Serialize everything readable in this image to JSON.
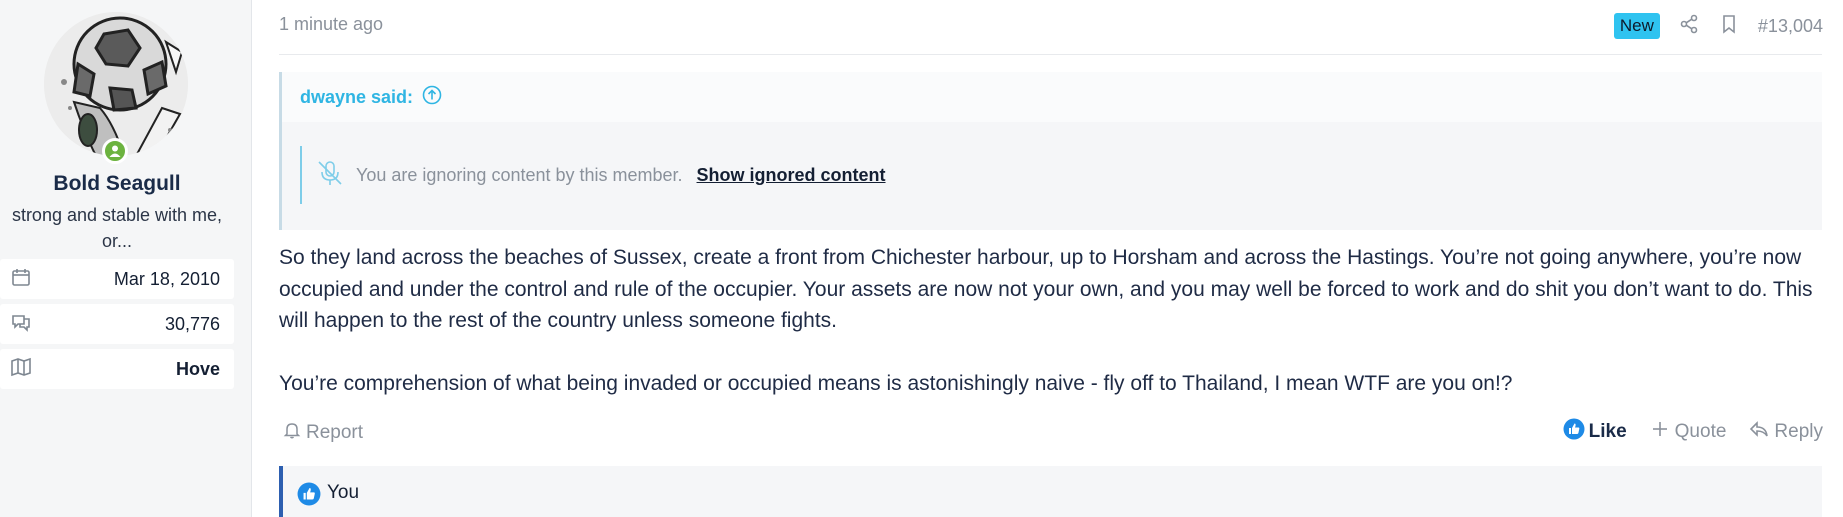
{
  "user": {
    "name": "Bold Seagull",
    "title": "strong and stable with me, or...",
    "icons": {
      "avatar": "football-cartoon-avatar",
      "online": "online-status-icon"
    },
    "stats": [
      {
        "icon": "calendar-icon",
        "value": "Mar 18, 2010"
      },
      {
        "icon": "messages-icon",
        "value": "30,776"
      },
      {
        "icon": "map-icon",
        "value": "Hove"
      }
    ]
  },
  "message": {
    "time": "1 minute ago",
    "badge": "New",
    "post_number": "#13,004",
    "quote": {
      "author": "dwayne said:",
      "ignored_text": "You are ignoring content by this member.",
      "ignored_link": "Show ignored content"
    },
    "body": [
      "So they land across the beaches of Sussex, create a front from Chichester harbour, up to Horsham and across the Hastings. You’re not going anywhere, you’re now occupied and under the control and rule of the occupier. Your assets are now not your own, and you may well be forced to work and do shit you don’t want to do. This will happen to the rest of the country unless someone fights.",
      "You’re comprehension of what being invaded or occupied means is astonishingly naive - fly off to Thailand, I mean WTF are you on!?"
    ],
    "actions": {
      "report": "Report",
      "like": "Like",
      "quote": "Quote",
      "reply": "Reply"
    },
    "reactions_label": "You"
  },
  "colors": {
    "accent": "#2fb5e3",
    "badge": "#2fc3f0",
    "like": "#1e8ae6",
    "online": "#6cb33f",
    "reaction_border": "#2d5fb0"
  }
}
